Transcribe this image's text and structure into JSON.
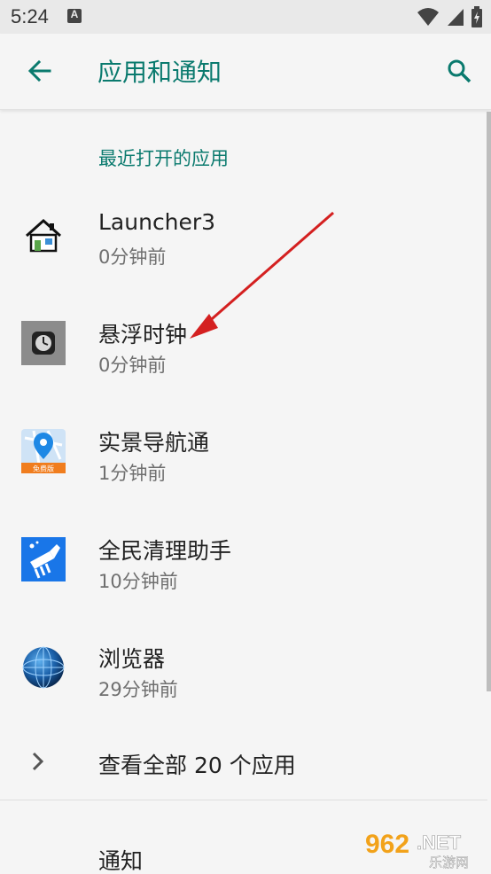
{
  "status_bar": {
    "time": "5:24",
    "notification_letter": "A"
  },
  "header": {
    "title": "应用和通知"
  },
  "recent": {
    "section_label": "最近打开的应用",
    "apps": [
      {
        "name": "Launcher3",
        "time": "0分钟前",
        "icon": "house-icon"
      },
      {
        "name": "悬浮时钟",
        "time": "0分钟前",
        "icon": "clock-icon"
      },
      {
        "name": "实景导航通",
        "time": "1分钟前",
        "icon": "map-pin-icon",
        "badge": "免费版"
      },
      {
        "name": "全民清理助手",
        "time": "10分钟前",
        "icon": "broom-icon"
      },
      {
        "name": "浏览器",
        "time": "29分钟前",
        "icon": "globe-icon"
      }
    ]
  },
  "see_all": {
    "label": "查看全部 20 个应用"
  },
  "notifications": {
    "label": "通知"
  },
  "watermark": {
    "brand": "962",
    "domain": ".NET",
    "sub": "乐游网"
  },
  "colors": {
    "accent": "#0a7a6e",
    "annotation_arrow": "#d42020"
  }
}
